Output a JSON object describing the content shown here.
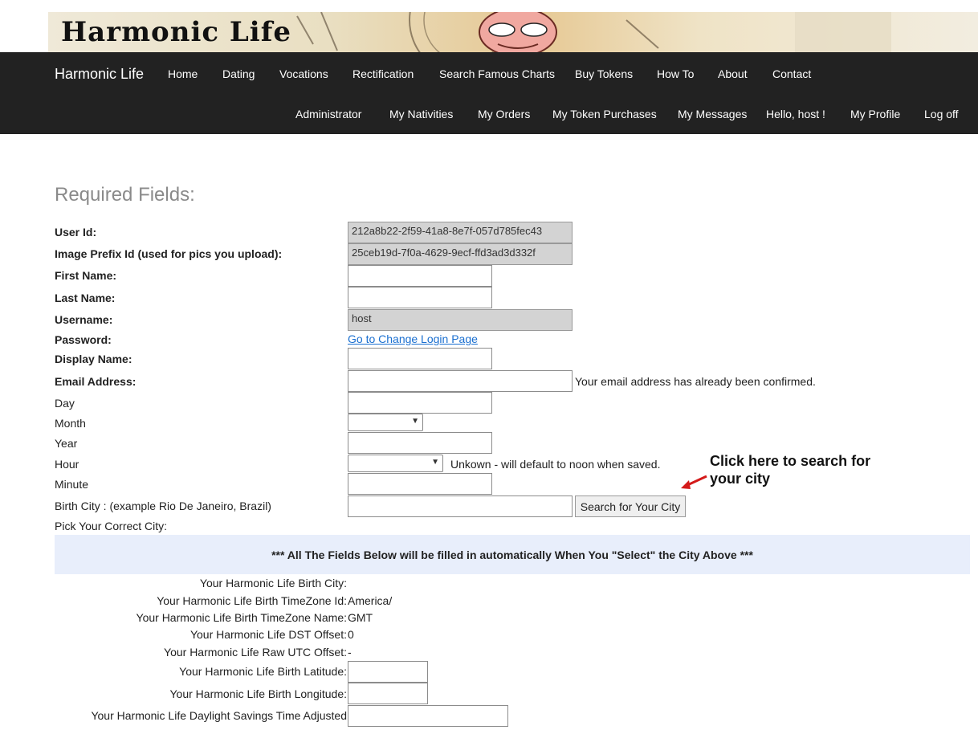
{
  "banner": {
    "logo_text": "Harmonic Life"
  },
  "nav": {
    "brand": "Harmonic Life",
    "primary": [
      "Home",
      "Dating",
      "Vocations",
      "Rectification",
      "Search Famous Charts",
      "Buy Tokens",
      "How To",
      "About",
      "Contact"
    ],
    "secondary": [
      "Administrator",
      "My Nativities",
      "My Orders",
      "My Token Purchases",
      "My Messages",
      "Hello, host !",
      "My Profile",
      "Log off"
    ]
  },
  "form": {
    "title": "Required Fields:",
    "user_id": {
      "label": "User Id:",
      "value": "212a8b22-2f59-41a8-8e7f-057d785fec43"
    },
    "image_prefix": {
      "label": "Image Prefix Id (used for pics you upload):",
      "value": "25ceb19d-7f0a-4629-9ecf-ffd3ad3d332f"
    },
    "first_name": {
      "label": "First Name:",
      "value": ""
    },
    "last_name": {
      "label": "Last Name:",
      "value": ""
    },
    "username": {
      "label": "Username:",
      "value": "host"
    },
    "password": {
      "label": "Password:",
      "link": "Go to Change Login Page"
    },
    "display_name": {
      "label": "Display Name:",
      "value": ""
    },
    "email": {
      "label": "Email Address:",
      "value": "",
      "note": "Your email address has already been confirmed."
    },
    "day": {
      "label": "Day"
    },
    "month": {
      "label": "Month"
    },
    "year": {
      "label": "Year"
    },
    "hour": {
      "label": "Hour",
      "note": "Unkown - will default to noon when saved."
    },
    "minute": {
      "label": "Minute"
    },
    "birth_city": {
      "label": "Birth City : (example Rio De Janeiro, Brazil)",
      "button": "Search for Your City"
    },
    "pick_city": {
      "label": "Pick Your Correct City:"
    },
    "callout": "Click here to search for\nyour city"
  },
  "auto_section": {
    "banner": "*** All The Fields Below will be filled in automatically When You \"Select\" the City Above ***",
    "birth_city": {
      "label": "Your Harmonic Life Birth City:",
      "value": ""
    },
    "tz_id": {
      "label": "Your Harmonic Life Birth TimeZone Id:",
      "value": "America/"
    },
    "tz_name": {
      "label": "Your Harmonic Life Birth TimeZone Name:",
      "value": "GMT"
    },
    "dst_offset": {
      "label": "Your Harmonic Life DST Offset:",
      "value": "0"
    },
    "raw_utc": {
      "label": "Your Harmonic Life Raw UTC Offset:",
      "value": "-"
    },
    "latitude": {
      "label": "Your Harmonic Life Birth Latitude:",
      "value": ""
    },
    "longitude": {
      "label": "Your Harmonic Life Birth Longitude:",
      "value": ""
    },
    "dst_adjusted": {
      "label": "Your Harmonic Life Daylight Savings Time Adjusted",
      "value": ""
    }
  }
}
